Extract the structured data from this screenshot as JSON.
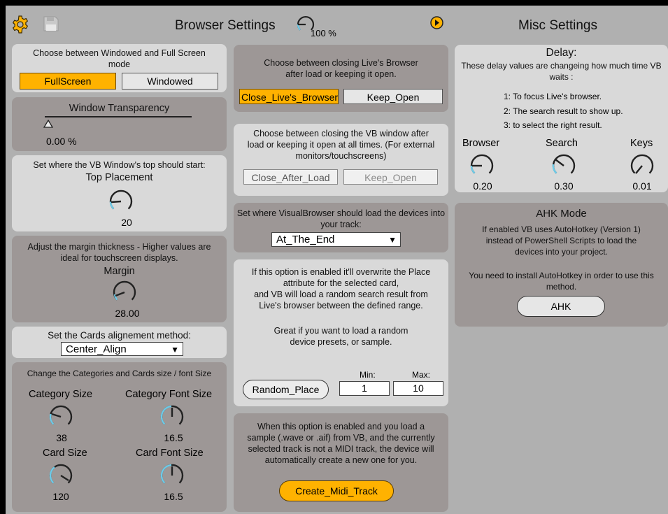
{
  "header": {
    "browser_title": "Browser Settings",
    "zoom": "100 %",
    "misc_title": "Misc Settings"
  },
  "colors": {
    "accent": "#ffb200",
    "panel_light": "#d9d9d9",
    "panel_dark": "#9d9796",
    "knob_arc": "#6ecbe8"
  },
  "left": {
    "mode": {
      "desc": "Choose between Windowed and Full Screen mode",
      "fullscreen": "FullScreen",
      "windowed": "Windowed",
      "selected": "FullScreen"
    },
    "transparency": {
      "label": "Window Transparency",
      "value": "0.00 %"
    },
    "top": {
      "desc": "Set where the VB Window's top should start:",
      "label": "Top Placement",
      "value": "20"
    },
    "margin": {
      "desc": "Adjust the margin thickness - Higher values are ideal for touchscreen displays.",
      "label": "Margin",
      "value": "28.00"
    },
    "align": {
      "desc": "Set the Cards alignement method:",
      "value": "Center_Align"
    },
    "sizes": {
      "desc": "Change the Categories and Cards size / font Size",
      "category_size": {
        "label": "Category Size",
        "value": "38"
      },
      "category_font": {
        "label": "Category Font Size",
        "value": "16.5"
      },
      "card_size": {
        "label": "Card Size",
        "value": "120"
      },
      "card_font": {
        "label": "Card Font Size",
        "value": "16.5"
      }
    }
  },
  "middle": {
    "close_browser": {
      "desc": "Choose between closing Live's Browser after load or keeping it open.",
      "close": "Close_Live's_Browser",
      "keep": "Keep_Open"
    },
    "close_window": {
      "desc": "Choose between closing the VB window after load or keeping it open at all times. (For external monitors/touchscreens)",
      "close": "Close_After_Load",
      "keep": "Keep_Open"
    },
    "load_pos": {
      "desc": "Set where VisualBrowser should load the devices into your track:",
      "value": "At_The_End"
    },
    "random": {
      "desc1": "If this option is enabled it'll overwrite the Place attribute for the selected card,",
      "desc2": "and  VB will load a random search result from Live's browser between the defined range.",
      "desc3": "Great if you want to load a random device presets, or sample.",
      "button": "Random_Place",
      "min_label": "Min:",
      "min": "1",
      "max_label": "Max:",
      "max": "10"
    },
    "midi": {
      "desc": "When this option is enabled and you load a sample (.wave or .aif) from VB, and the currently selected track is not a MIDI track, the device will automatically create a new one for you.",
      "button": "Create_Midi_Track"
    }
  },
  "right": {
    "delay": {
      "title": "Delay:",
      "desc": "These delay values are changeing how much time VB waits :",
      "item1": "1:  To focus Live's browser.",
      "item2": "2:  The search result to show up.",
      "item3": "3:  to select the right result.",
      "browser": {
        "label": "Browser",
        "value": "0.20"
      },
      "search": {
        "label": "Search",
        "value": "0.30"
      },
      "keys": {
        "label": "Keys",
        "value": "0.01"
      }
    },
    "ahk": {
      "title": "AHK Mode",
      "desc": "If enabled VB uses AutoHotkey (Version 1) instead of  PowerShell Scripts to load the devices into your project.",
      "note": "You need to install AutoHotkey in order to use this method.",
      "button": "AHK"
    }
  }
}
